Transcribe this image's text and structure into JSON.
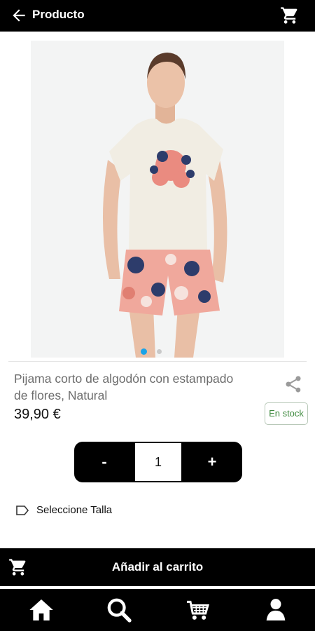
{
  "header": {
    "title": "Producto",
    "back_icon": "arrow-left-icon",
    "cart_icon": "cart-icon"
  },
  "gallery": {
    "image": "woman wearing cream t-shirt and pink floral shorts pajama",
    "active_index": 0,
    "total": 2,
    "active_color": "#1aa3e8",
    "inactive_color": "#c9c9c9"
  },
  "product": {
    "name": "Pijama corto de algodón con estampado de flores, Natural",
    "price": "39,90 €",
    "stock": "En stock"
  },
  "quantity": {
    "minus": "-",
    "value": "1",
    "plus": "+"
  },
  "size": {
    "label": "Seleccione Talla",
    "icon": "tag-icon"
  },
  "add_to_cart": {
    "label": "Añadir al carrito",
    "icon": "cart-icon"
  },
  "bottom_nav": {
    "items": [
      {
        "icon": "home-icon"
      },
      {
        "icon": "search-icon"
      },
      {
        "icon": "cart-icon"
      },
      {
        "icon": "user-icon"
      }
    ]
  },
  "colors": {
    "bar": "#000000",
    "stock_green": "#3f8a3f",
    "price": "#111111"
  }
}
